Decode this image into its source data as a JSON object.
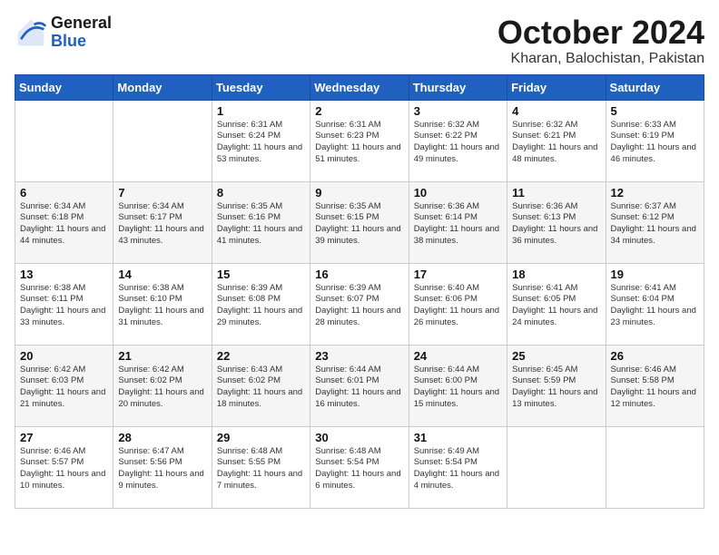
{
  "header": {
    "logo_general": "General",
    "logo_blue": "Blue",
    "month": "October 2024",
    "location": "Kharan, Balochistan, Pakistan"
  },
  "weekdays": [
    "Sunday",
    "Monday",
    "Tuesday",
    "Wednesday",
    "Thursday",
    "Friday",
    "Saturday"
  ],
  "weeks": [
    [
      {
        "day": "",
        "info": ""
      },
      {
        "day": "",
        "info": ""
      },
      {
        "day": "1",
        "info": "Sunrise: 6:31 AM\nSunset: 6:24 PM\nDaylight: 11 hours and 53 minutes."
      },
      {
        "day": "2",
        "info": "Sunrise: 6:31 AM\nSunset: 6:23 PM\nDaylight: 11 hours and 51 minutes."
      },
      {
        "day": "3",
        "info": "Sunrise: 6:32 AM\nSunset: 6:22 PM\nDaylight: 11 hours and 49 minutes."
      },
      {
        "day": "4",
        "info": "Sunrise: 6:32 AM\nSunset: 6:21 PM\nDaylight: 11 hours and 48 minutes."
      },
      {
        "day": "5",
        "info": "Sunrise: 6:33 AM\nSunset: 6:19 PM\nDaylight: 11 hours and 46 minutes."
      }
    ],
    [
      {
        "day": "6",
        "info": "Sunrise: 6:34 AM\nSunset: 6:18 PM\nDaylight: 11 hours and 44 minutes."
      },
      {
        "day": "7",
        "info": "Sunrise: 6:34 AM\nSunset: 6:17 PM\nDaylight: 11 hours and 43 minutes."
      },
      {
        "day": "8",
        "info": "Sunrise: 6:35 AM\nSunset: 6:16 PM\nDaylight: 11 hours and 41 minutes."
      },
      {
        "day": "9",
        "info": "Sunrise: 6:35 AM\nSunset: 6:15 PM\nDaylight: 11 hours and 39 minutes."
      },
      {
        "day": "10",
        "info": "Sunrise: 6:36 AM\nSunset: 6:14 PM\nDaylight: 11 hours and 38 minutes."
      },
      {
        "day": "11",
        "info": "Sunrise: 6:36 AM\nSunset: 6:13 PM\nDaylight: 11 hours and 36 minutes."
      },
      {
        "day": "12",
        "info": "Sunrise: 6:37 AM\nSunset: 6:12 PM\nDaylight: 11 hours and 34 minutes."
      }
    ],
    [
      {
        "day": "13",
        "info": "Sunrise: 6:38 AM\nSunset: 6:11 PM\nDaylight: 11 hours and 33 minutes."
      },
      {
        "day": "14",
        "info": "Sunrise: 6:38 AM\nSunset: 6:10 PM\nDaylight: 11 hours and 31 minutes."
      },
      {
        "day": "15",
        "info": "Sunrise: 6:39 AM\nSunset: 6:08 PM\nDaylight: 11 hours and 29 minutes."
      },
      {
        "day": "16",
        "info": "Sunrise: 6:39 AM\nSunset: 6:07 PM\nDaylight: 11 hours and 28 minutes."
      },
      {
        "day": "17",
        "info": "Sunrise: 6:40 AM\nSunset: 6:06 PM\nDaylight: 11 hours and 26 minutes."
      },
      {
        "day": "18",
        "info": "Sunrise: 6:41 AM\nSunset: 6:05 PM\nDaylight: 11 hours and 24 minutes."
      },
      {
        "day": "19",
        "info": "Sunrise: 6:41 AM\nSunset: 6:04 PM\nDaylight: 11 hours and 23 minutes."
      }
    ],
    [
      {
        "day": "20",
        "info": "Sunrise: 6:42 AM\nSunset: 6:03 PM\nDaylight: 11 hours and 21 minutes."
      },
      {
        "day": "21",
        "info": "Sunrise: 6:42 AM\nSunset: 6:02 PM\nDaylight: 11 hours and 20 minutes."
      },
      {
        "day": "22",
        "info": "Sunrise: 6:43 AM\nSunset: 6:02 PM\nDaylight: 11 hours and 18 minutes."
      },
      {
        "day": "23",
        "info": "Sunrise: 6:44 AM\nSunset: 6:01 PM\nDaylight: 11 hours and 16 minutes."
      },
      {
        "day": "24",
        "info": "Sunrise: 6:44 AM\nSunset: 6:00 PM\nDaylight: 11 hours and 15 minutes."
      },
      {
        "day": "25",
        "info": "Sunrise: 6:45 AM\nSunset: 5:59 PM\nDaylight: 11 hours and 13 minutes."
      },
      {
        "day": "26",
        "info": "Sunrise: 6:46 AM\nSunset: 5:58 PM\nDaylight: 11 hours and 12 minutes."
      }
    ],
    [
      {
        "day": "27",
        "info": "Sunrise: 6:46 AM\nSunset: 5:57 PM\nDaylight: 11 hours and 10 minutes."
      },
      {
        "day": "28",
        "info": "Sunrise: 6:47 AM\nSunset: 5:56 PM\nDaylight: 11 hours and 9 minutes."
      },
      {
        "day": "29",
        "info": "Sunrise: 6:48 AM\nSunset: 5:55 PM\nDaylight: 11 hours and 7 minutes."
      },
      {
        "day": "30",
        "info": "Sunrise: 6:48 AM\nSunset: 5:54 PM\nDaylight: 11 hours and 6 minutes."
      },
      {
        "day": "31",
        "info": "Sunrise: 6:49 AM\nSunset: 5:54 PM\nDaylight: 11 hours and 4 minutes."
      },
      {
        "day": "",
        "info": ""
      },
      {
        "day": "",
        "info": ""
      }
    ]
  ]
}
